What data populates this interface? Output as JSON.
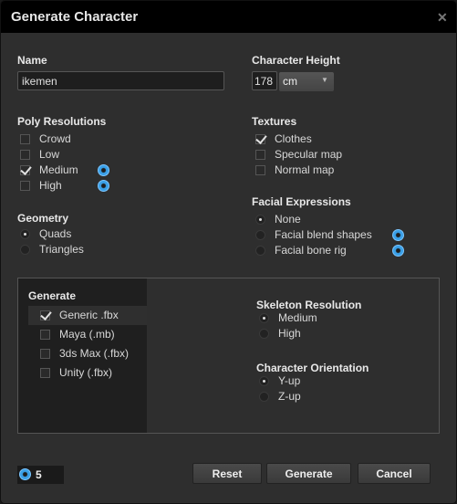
{
  "title": "Generate Character",
  "name": {
    "label": "Name",
    "value": "ikemen"
  },
  "height": {
    "label": "Character Height",
    "value": "178",
    "unit": "cm"
  },
  "poly": {
    "label": "Poly Resolutions",
    "items": [
      {
        "label": "Crowd",
        "checked": false
      },
      {
        "label": "Low",
        "checked": false
      },
      {
        "label": "Medium",
        "checked": true
      },
      {
        "label": "High",
        "checked": false
      }
    ]
  },
  "geometry": {
    "label": "Geometry",
    "items": [
      {
        "label": "Quads",
        "selected": true
      },
      {
        "label": "Triangles",
        "selected": false
      }
    ]
  },
  "textures": {
    "label": "Textures",
    "items": [
      {
        "label": "Clothes",
        "checked": true
      },
      {
        "label": "Specular map",
        "checked": false
      },
      {
        "label": "Normal map",
        "checked": false
      }
    ]
  },
  "facial": {
    "label": "Facial Expressions",
    "items": [
      {
        "label": "None",
        "selected": true
      },
      {
        "label": "Facial blend shapes",
        "selected": false
      },
      {
        "label": "Facial bone rig",
        "selected": false
      }
    ]
  },
  "generate": {
    "label": "Generate",
    "items": [
      {
        "label": "Generic .fbx",
        "checked": true
      },
      {
        "label": "Maya (.mb)",
        "checked": false
      },
      {
        "label": "3ds Max (.fbx)",
        "checked": false
      },
      {
        "label": "Unity (.fbx)",
        "checked": false
      }
    ]
  },
  "skeleton": {
    "label": "Skeleton Resolution",
    "items": [
      {
        "label": "Medium",
        "selected": true
      },
      {
        "label": "High",
        "selected": false
      }
    ]
  },
  "orientation": {
    "label": "Character Orientation",
    "items": [
      {
        "label": "Y-up",
        "selected": true
      },
      {
        "label": "Z-up",
        "selected": false
      }
    ]
  },
  "credits": "5",
  "buttons": {
    "reset": "Reset",
    "generate": "Generate",
    "cancel": "Cancel"
  },
  "accent": "#3aa0e8"
}
